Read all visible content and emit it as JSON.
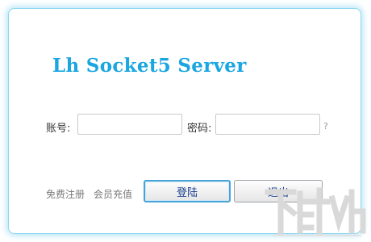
{
  "app": {
    "title": "Lh Socket5 Server"
  },
  "form": {
    "account_label": "账号:",
    "account_value": "",
    "password_label": "密码:",
    "password_value": "",
    "help_glyph": "?"
  },
  "footer": {
    "register_label": "免费注册",
    "recharge_label": "会员充值",
    "login_label": "登陆",
    "exit_label": "退出"
  },
  "colors": {
    "title": "#1aa6e0",
    "dialog_border": "#8fd6f0",
    "primary_button_border": "#47a3d8"
  }
}
